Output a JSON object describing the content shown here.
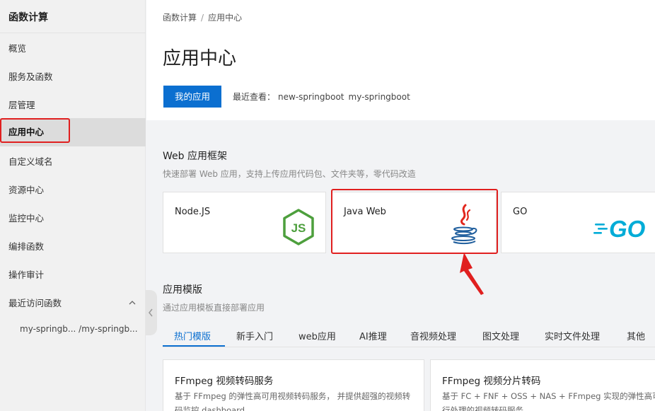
{
  "sidebar": {
    "title": "函数计算",
    "items": [
      {
        "label": "概览"
      },
      {
        "label": "服务及函数"
      },
      {
        "label": "层管理"
      },
      {
        "label": "应用中心",
        "active": true
      },
      {
        "label": "自定义域名"
      },
      {
        "label": "资源中心"
      },
      {
        "label": "监控中心"
      },
      {
        "label": "编排函数"
      },
      {
        "label": "操作审计"
      },
      {
        "label": "最近访问函数",
        "expanded": true
      }
    ],
    "recent_functions": "my-springb... /my-springb..."
  },
  "header": {
    "breadcrumb": [
      "函数计算",
      "应用中心"
    ],
    "title": "应用中心",
    "my_apps_button": "我的应用",
    "recent_label": "最近查看：",
    "recent_apps": [
      "new-springboot",
      "my-springboot"
    ]
  },
  "web_frameworks": {
    "title": "Web 应用框架",
    "description": "快速部署 Web 应用，支持上传应用代码包、文件夹等，零代码改造",
    "cards": [
      {
        "label": "Node.JS",
        "icon": "nodejs-icon"
      },
      {
        "label": "Java Web",
        "icon": "java-icon"
      },
      {
        "label": "GO",
        "icon": "go-icon"
      }
    ]
  },
  "templates": {
    "title": "应用模版",
    "description": "通过应用模板直接部署应用",
    "tabs": [
      {
        "label": "热门模版",
        "active": true
      },
      {
        "label": "新手入门"
      },
      {
        "label": "web应用"
      },
      {
        "label": "AI推理"
      },
      {
        "label": "音视频处理"
      },
      {
        "label": "图文处理"
      },
      {
        "label": "实时文件处理"
      },
      {
        "label": "其他"
      }
    ],
    "cards": [
      {
        "title": "FFmpeg 视频转码服务",
        "desc": "基于 FFmpeg 的弹性高可用视频转码服务， 并提供超强的视频转码监控 dashboard。"
      },
      {
        "title": "FFmpeg 视频分片转码",
        "desc": "基于 FC + FNF + OSS + NAS + FFmpeg 实现的弹性高可用并行处理的视频转码服务。"
      }
    ]
  },
  "colors": {
    "primary": "#0b6fd0",
    "highlight": "#e01f1f",
    "node_green": "#4d9f3d",
    "go_blue": "#00acd7",
    "java_red": "#e2261c",
    "java_blue": "#1f5e9d"
  }
}
